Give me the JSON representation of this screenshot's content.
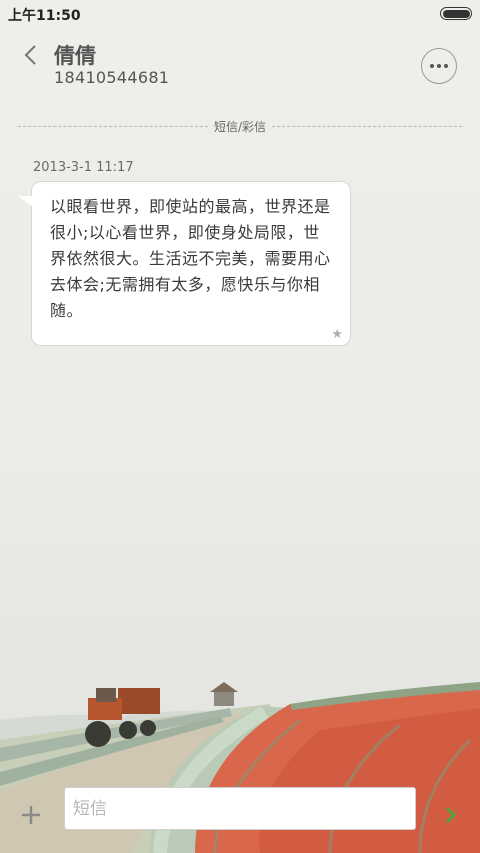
{
  "status_bar": {
    "time": "上午11:50",
    "battery_icon": "battery-icon"
  },
  "header": {
    "back_icon": "chevron-left-icon",
    "contact_name": "倩倩",
    "contact_number": "18410544681",
    "more_icon": "more-dots-icon"
  },
  "conversation": {
    "divider_label": "短信/彩信",
    "messages": [
      {
        "timestamp": "2013-3-1 11:17",
        "text": "以眼看世界，即使站的最高，世界还是很小;以心看世界，即使身处局限，世界依然很大。生活远不完美，需要用心去体会;无需拥有太多，愿快乐与你相随。",
        "star_icon": "star-icon",
        "star_glyph": "★"
      }
    ]
  },
  "composer": {
    "add_icon": "plus-icon",
    "placeholder": "短信",
    "value": "",
    "send_icon": "send-icon"
  },
  "colors": {
    "accent_green": "#3fae3a",
    "bubble_bg": "#ffffff",
    "text_primary": "#3a3a3a"
  }
}
